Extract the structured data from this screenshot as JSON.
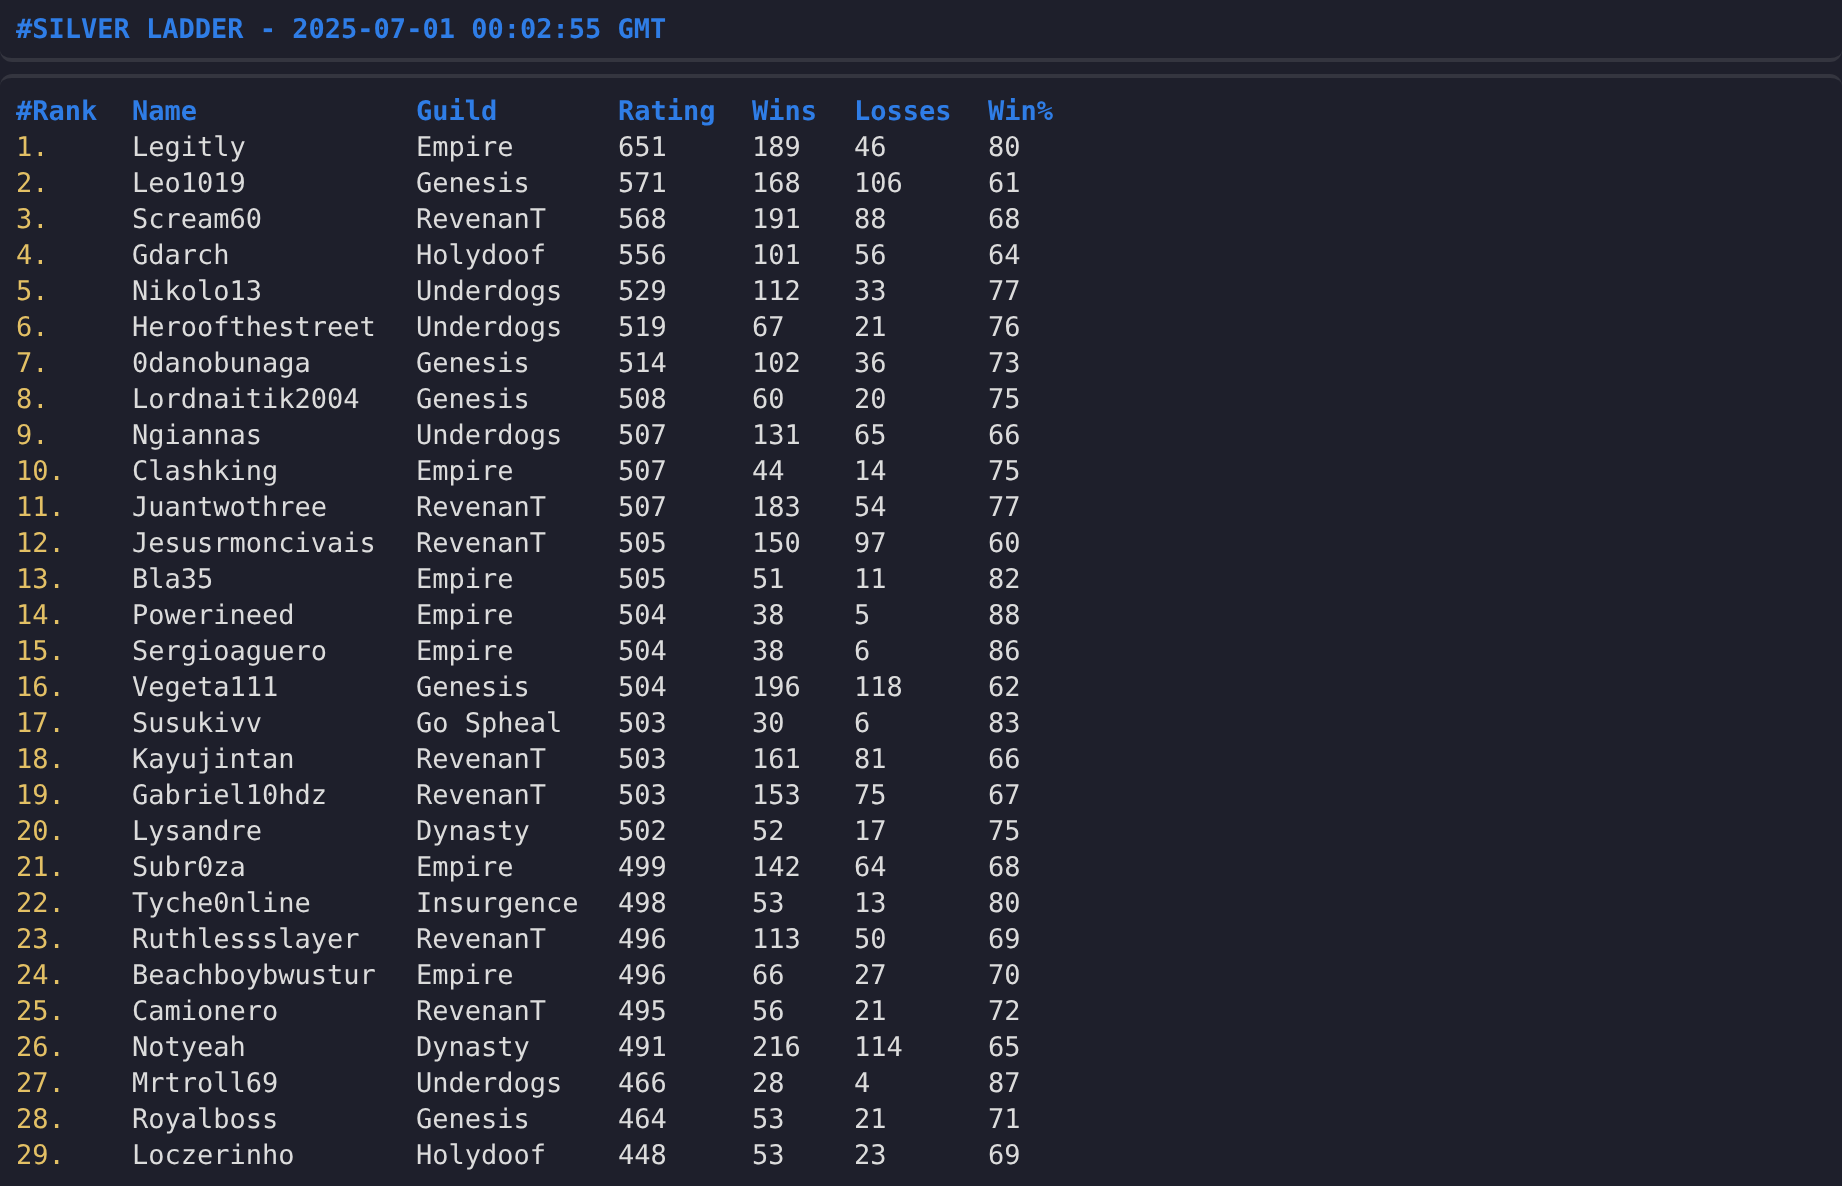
{
  "title": "#SILVER LADDER - 2025-07-01 00:02:55 GMT",
  "table": {
    "columns": [
      "#Rank",
      "Name",
      "Guild",
      "Rating",
      "Wins",
      "Losses",
      "Win%"
    ],
    "rows": [
      [
        "1.",
        "Legitly",
        "Empire",
        "651",
        "189",
        "46",
        "80"
      ],
      [
        "2.",
        "Leo1019",
        "Genesis",
        "571",
        "168",
        "106",
        "61"
      ],
      [
        "3.",
        "Scream60",
        "RevenanT",
        "568",
        "191",
        "88",
        "68"
      ],
      [
        "4.",
        "Gdarch",
        "Holydoof",
        "556",
        "101",
        "56",
        "64"
      ],
      [
        "5.",
        "Nikolo13",
        "Underdogs",
        "529",
        "112",
        "33",
        "77"
      ],
      [
        "6.",
        "Heroofthestreet",
        "Underdogs",
        "519",
        "67",
        "21",
        "76"
      ],
      [
        "7.",
        "0danobunaga",
        "Genesis",
        "514",
        "102",
        "36",
        "73"
      ],
      [
        "8.",
        "Lordnaitik2004",
        "Genesis",
        "508",
        "60",
        "20",
        "75"
      ],
      [
        "9.",
        "Ngiannas",
        "Underdogs",
        "507",
        "131",
        "65",
        "66"
      ],
      [
        "10.",
        "Clashking",
        "Empire",
        "507",
        "44",
        "14",
        "75"
      ],
      [
        "11.",
        "Juantwothree",
        "RevenanT",
        "507",
        "183",
        "54",
        "77"
      ],
      [
        "12.",
        "Jesusrmoncivais",
        "RevenanT",
        "505",
        "150",
        "97",
        "60"
      ],
      [
        "13.",
        "Bla35",
        "Empire",
        "505",
        "51",
        "11",
        "82"
      ],
      [
        "14.",
        "Powerineed",
        "Empire",
        "504",
        "38",
        "5",
        "88"
      ],
      [
        "15.",
        "Sergioaguero",
        "Empire",
        "504",
        "38",
        "6",
        "86"
      ],
      [
        "16.",
        "Vegeta111",
        "Genesis",
        "504",
        "196",
        "118",
        "62"
      ],
      [
        "17.",
        "Susukivv",
        "Go Spheal",
        "503",
        "30",
        "6",
        "83"
      ],
      [
        "18.",
        "Kayujintan",
        "RevenanT",
        "503",
        "161",
        "81",
        "66"
      ],
      [
        "19.",
        "Gabriel10hdz",
        "RevenanT",
        "503",
        "153",
        "75",
        "67"
      ],
      [
        "20.",
        "Lysandre",
        "Dynasty",
        "502",
        "52",
        "17",
        "75"
      ],
      [
        "21.",
        "Subr0za",
        "Empire",
        "499",
        "142",
        "64",
        "68"
      ],
      [
        "22.",
        "Tyche0nline",
        "Insurgence",
        "498",
        "53",
        "13",
        "80"
      ],
      [
        "23.",
        "Ruthlessslayer",
        "RevenanT",
        "496",
        "113",
        "50",
        "69"
      ],
      [
        "24.",
        "Beachboybwustur",
        "Empire",
        "496",
        "66",
        "27",
        "70"
      ],
      [
        "25.",
        "Camionero",
        "RevenanT",
        "495",
        "56",
        "21",
        "72"
      ],
      [
        "26.",
        "Notyeah",
        "Dynasty",
        "491",
        "216",
        "114",
        "65"
      ],
      [
        "27.",
        "Mrtroll69",
        "Underdogs",
        "466",
        "28",
        "4",
        "87"
      ],
      [
        "28.",
        "Royalboss",
        "Genesis",
        "464",
        "53",
        "21",
        "71"
      ],
      [
        "29.",
        "Loczerinho",
        "Holydoof",
        "448",
        "53",
        "23",
        "69"
      ]
    ]
  }
}
